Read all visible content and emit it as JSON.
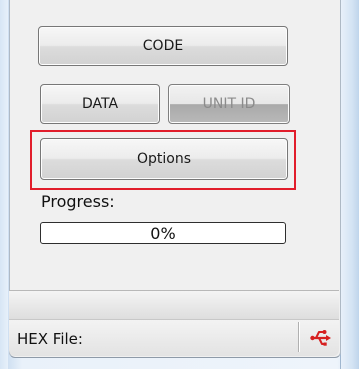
{
  "buttons": {
    "code_label": "CODE",
    "data_label": "DATA",
    "unit_id_label": "UNIT ID",
    "options_label": "Options"
  },
  "progress": {
    "label": "Progress:",
    "value_text": "0%",
    "value": 0
  },
  "statusbar": {
    "hex_file_label": "HEX File:",
    "connection_icon": "usb-icon"
  },
  "colors": {
    "highlight": "#e11d2b",
    "usb_icon_red": "#d62020"
  }
}
